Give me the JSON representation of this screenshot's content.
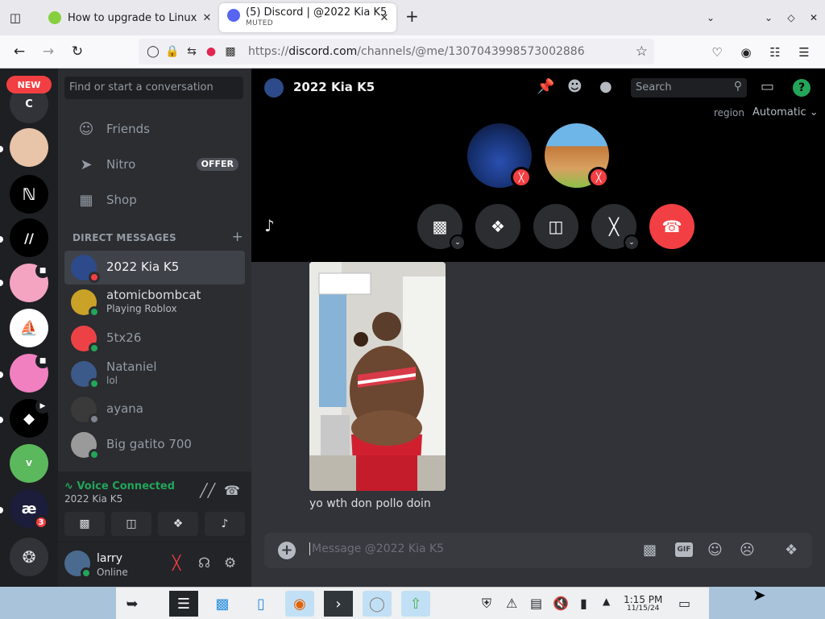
{
  "browser": {
    "tabs": [
      {
        "title": "How to upgrade to Linux M",
        "active": false
      },
      {
        "title": "(5) Discord | @2022 Kia K5",
        "status": "MUTED",
        "active": true
      }
    ],
    "url_domain": "discord.com",
    "url_scheme": "https://",
    "url_path": "/channels/@me/1307043998573002886"
  },
  "servers": {
    "new_badge": "NEW",
    "top_letter": "C",
    "mention_badge": "3"
  },
  "dm_panel": {
    "search_placeholder": "Find or start a conversation",
    "nav": [
      {
        "label": "Friends",
        "icon": "friends-icon"
      },
      {
        "label": "Nitro",
        "icon": "nitro-icon",
        "badge": "OFFER"
      },
      {
        "label": "Shop",
        "icon": "shop-icon"
      }
    ],
    "header": "DIRECT MESSAGES",
    "dms": [
      {
        "name": "2022 Kia K5",
        "sub": "",
        "status": "dnd",
        "selected": true,
        "avatar_color": "#2d4a8a"
      },
      {
        "name": "atomicbombcat",
        "sub": "Playing Roblox",
        "status": "online",
        "selected": false,
        "avatar_color": "#c9a227"
      },
      {
        "name": "5tx26",
        "sub": "",
        "status": "online",
        "selected": false,
        "avatar_color": "#ed4245"
      },
      {
        "name": "Nataniel",
        "sub": "lol",
        "status": "online",
        "selected": false,
        "avatar_color": "#3b5a8a"
      },
      {
        "name": "ayana",
        "sub": "",
        "status": "offline",
        "selected": false,
        "avatar_color": "#3a3a3a"
      },
      {
        "name": "Big gatito 700",
        "sub": "",
        "status": "online",
        "selected": false,
        "avatar_color": "#9a9a9a"
      }
    ],
    "voice": {
      "title": "Voice Connected",
      "channel": "2022 Kia K5"
    },
    "user": {
      "name": "larry",
      "status": "Online"
    }
  },
  "call": {
    "title": "2022 Kia K5",
    "search_placeholder": "Search",
    "region_label": "region",
    "region_value": "Automatic"
  },
  "chat": {
    "message_text": "yo wth don pollo doin",
    "composer_placeholder": "Message @2022 Kia K5",
    "gif_label": "GIF"
  },
  "taskbar": {
    "time": "1:15 PM",
    "date": "11/15/24"
  },
  "colors": {
    "accent_red": "#f23f43",
    "online_green": "#23a55a",
    "discord_bg": "#313338"
  }
}
